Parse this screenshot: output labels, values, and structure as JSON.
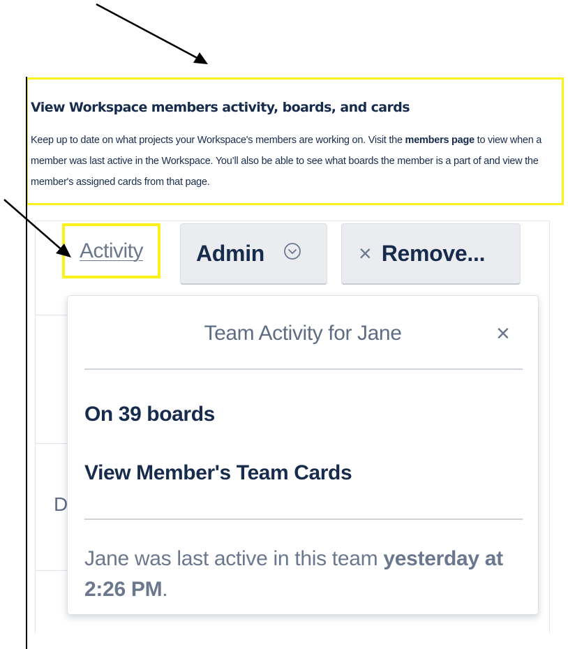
{
  "callout": {
    "title": "View Workspace members activity, boards, and cards",
    "body_part1": "Keep up to date on what projects your Workspace's members are working on. Visit the ",
    "body_bold": "members page",
    "body_part2": " to view when a member was last active in the Workspace. You’ll also be able to see what boards the member is a part of and view the member's assigned cards from that page."
  },
  "member_row": {
    "activity_link": "Activity",
    "admin_button": "Admin",
    "remove_button": "Remove...",
    "side_letters": [
      "D"
    ]
  },
  "popover": {
    "title": "Team Activity for Jane",
    "close_glyph": "×",
    "boards_count_label": "On 39 boards",
    "view_cards_link": "View Member's Team Cards",
    "last_active_prefix": "Jane was last active in this team ",
    "last_active_when": "yesterday at 2:26 PM",
    "last_active_suffix": "."
  },
  "icons": {
    "admin_dropdown": "chevron-down-circle-icon",
    "remove": "close-icon",
    "popover_close": "close-icon"
  },
  "colors": {
    "highlight": "#fbf21b",
    "text_dark": "#172b4d",
    "text_muted": "#6b778c",
    "button_bg": "#ebecf0"
  }
}
